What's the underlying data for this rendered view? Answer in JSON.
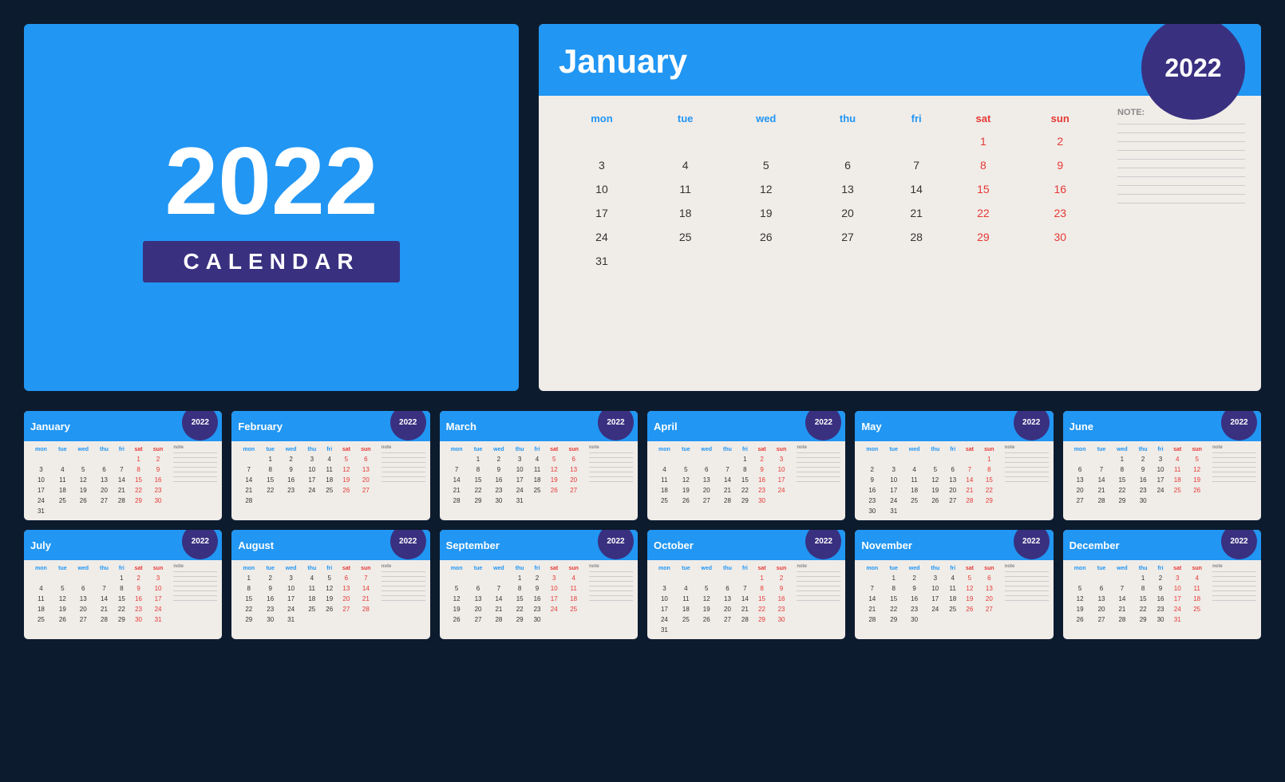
{
  "cover": {
    "year": "2022",
    "label": "CALENDAR"
  },
  "january_detail": {
    "month": "January",
    "year": "2022",
    "notes_label": "NOTE:",
    "days_header": [
      "mon",
      "tue",
      "wed",
      "thu",
      "fri",
      "sat",
      "sun"
    ],
    "weeks": [
      [
        "",
        "",
        "",
        "",
        "",
        "1",
        "2"
      ],
      [
        "3",
        "4",
        "5",
        "6",
        "7",
        "8",
        "9"
      ],
      [
        "10",
        "11",
        "12",
        "13",
        "14",
        "15",
        "16"
      ],
      [
        "17",
        "18",
        "19",
        "20",
        "21",
        "22",
        "23"
      ],
      [
        "24",
        "25",
        "26",
        "27",
        "28",
        "29",
        "30"
      ],
      [
        "31",
        "",
        "",
        "",
        "",
        "",
        ""
      ]
    ]
  },
  "months": [
    {
      "name": "January",
      "year": "2022",
      "weeks": [
        [
          "",
          "",
          "",
          "",
          "",
          "1",
          "2"
        ],
        [
          "3",
          "4",
          "5",
          "6",
          "7",
          "8",
          "9"
        ],
        [
          "10",
          "11",
          "12",
          "13",
          "14",
          "15",
          "16"
        ],
        [
          "17",
          "18",
          "19",
          "20",
          "21",
          "22",
          "23"
        ],
        [
          "24",
          "25",
          "26",
          "27",
          "28",
          "29",
          "30"
        ],
        [
          "31",
          "",
          "",
          "",
          "",
          "",
          ""
        ]
      ]
    },
    {
      "name": "February",
      "year": "2022",
      "weeks": [
        [
          "",
          "1",
          "2",
          "3",
          "4",
          "5",
          "6"
        ],
        [
          "7",
          "8",
          "9",
          "10",
          "11",
          "12",
          "13"
        ],
        [
          "14",
          "15",
          "16",
          "17",
          "18",
          "19",
          "20"
        ],
        [
          "21",
          "22",
          "23",
          "24",
          "25",
          "26",
          "27"
        ],
        [
          "28",
          "",
          "",
          "",
          "",
          "",
          ""
        ]
      ]
    },
    {
      "name": "March",
      "year": "2022",
      "weeks": [
        [
          "",
          "1",
          "2",
          "3",
          "4",
          "5",
          "6"
        ],
        [
          "7",
          "8",
          "9",
          "10",
          "11",
          "12",
          "13"
        ],
        [
          "14",
          "15",
          "16",
          "17",
          "18",
          "19",
          "20"
        ],
        [
          "21",
          "22",
          "23",
          "24",
          "25",
          "26",
          "27"
        ],
        [
          "28",
          "29",
          "30",
          "31",
          "",
          "",
          ""
        ]
      ]
    },
    {
      "name": "April",
      "year": "2022",
      "weeks": [
        [
          "",
          "",
          "",
          "",
          "1",
          "2",
          "3"
        ],
        [
          "4",
          "5",
          "6",
          "7",
          "8",
          "9",
          "10"
        ],
        [
          "11",
          "12",
          "13",
          "14",
          "15",
          "16",
          "17"
        ],
        [
          "18",
          "19",
          "20",
          "21",
          "22",
          "23",
          "24"
        ],
        [
          "25",
          "26",
          "27",
          "28",
          "29",
          "30",
          ""
        ]
      ]
    },
    {
      "name": "May",
      "year": "2022",
      "weeks": [
        [
          "",
          "",
          "",
          "",
          "",
          "",
          "1"
        ],
        [
          "2",
          "3",
          "4",
          "5",
          "6",
          "7",
          "8"
        ],
        [
          "9",
          "10",
          "11",
          "12",
          "13",
          "14",
          "15"
        ],
        [
          "16",
          "17",
          "18",
          "19",
          "20",
          "21",
          "22"
        ],
        [
          "23",
          "24",
          "25",
          "26",
          "27",
          "28",
          "29"
        ],
        [
          "30",
          "31",
          "",
          "",
          "",
          "",
          ""
        ]
      ]
    },
    {
      "name": "June",
      "year": "2022",
      "weeks": [
        [
          "",
          "",
          "1",
          "2",
          "3",
          "4",
          "5"
        ],
        [
          "6",
          "7",
          "8",
          "9",
          "10",
          "11",
          "12"
        ],
        [
          "13",
          "14",
          "15",
          "16",
          "17",
          "18",
          "19"
        ],
        [
          "20",
          "21",
          "22",
          "23",
          "24",
          "25",
          "26"
        ],
        [
          "27",
          "28",
          "29",
          "30",
          "",
          "",
          ""
        ]
      ]
    },
    {
      "name": "July",
      "year": "2022",
      "weeks": [
        [
          "",
          "",
          "",
          "",
          "1",
          "2",
          "3"
        ],
        [
          "4",
          "5",
          "6",
          "7",
          "8",
          "9",
          "10"
        ],
        [
          "11",
          "12",
          "13",
          "14",
          "15",
          "16",
          "17"
        ],
        [
          "18",
          "19",
          "20",
          "21",
          "22",
          "23",
          "24"
        ],
        [
          "25",
          "26",
          "27",
          "28",
          "29",
          "30",
          "31"
        ]
      ]
    },
    {
      "name": "August",
      "year": "2022",
      "weeks": [
        [
          "1",
          "2",
          "3",
          "4",
          "5",
          "6",
          "7"
        ],
        [
          "8",
          "9",
          "10",
          "11",
          "12",
          "13",
          "14"
        ],
        [
          "15",
          "16",
          "17",
          "18",
          "19",
          "20",
          "21"
        ],
        [
          "22",
          "23",
          "24",
          "25",
          "26",
          "27",
          "28"
        ],
        [
          "29",
          "30",
          "31",
          "",
          "",
          "",
          ""
        ]
      ]
    },
    {
      "name": "September",
      "year": "2022",
      "weeks": [
        [
          "",
          "",
          "",
          "1",
          "2",
          "3",
          "4"
        ],
        [
          "5",
          "6",
          "7",
          "8",
          "9",
          "10",
          "11"
        ],
        [
          "12",
          "13",
          "14",
          "15",
          "16",
          "17",
          "18"
        ],
        [
          "19",
          "20",
          "21",
          "22",
          "23",
          "24",
          "25"
        ],
        [
          "26",
          "27",
          "28",
          "29",
          "30",
          "",
          ""
        ]
      ]
    },
    {
      "name": "October",
      "year": "2022",
      "weeks": [
        [
          "",
          "",
          "",
          "",
          "",
          "1",
          "2"
        ],
        [
          "3",
          "4",
          "5",
          "6",
          "7",
          "8",
          "9"
        ],
        [
          "10",
          "11",
          "12",
          "13",
          "14",
          "15",
          "16"
        ],
        [
          "17",
          "18",
          "19",
          "20",
          "21",
          "22",
          "23"
        ],
        [
          "24",
          "25",
          "26",
          "27",
          "28",
          "29",
          "30"
        ],
        [
          "31",
          "",
          "",
          "",
          "",
          "",
          ""
        ]
      ]
    },
    {
      "name": "November",
      "year": "2022",
      "weeks": [
        [
          "",
          "1",
          "2",
          "3",
          "4",
          "5",
          "6"
        ],
        [
          "7",
          "8",
          "9",
          "10",
          "11",
          "12",
          "13"
        ],
        [
          "14",
          "15",
          "16",
          "17",
          "18",
          "19",
          "20"
        ],
        [
          "21",
          "22",
          "23",
          "24",
          "25",
          "26",
          "27"
        ],
        [
          "28",
          "29",
          "30",
          "",
          "",
          "",
          ""
        ]
      ]
    },
    {
      "name": "December",
      "year": "2022",
      "weeks": [
        [
          "",
          "",
          "",
          "1",
          "2",
          "3",
          "4"
        ],
        [
          "5",
          "6",
          "7",
          "8",
          "9",
          "10",
          "11"
        ],
        [
          "12",
          "13",
          "14",
          "15",
          "16",
          "17",
          "18"
        ],
        [
          "19",
          "20",
          "21",
          "22",
          "23",
          "24",
          "25"
        ],
        [
          "26",
          "27",
          "28",
          "29",
          "30",
          "31",
          ""
        ]
      ]
    }
  ]
}
